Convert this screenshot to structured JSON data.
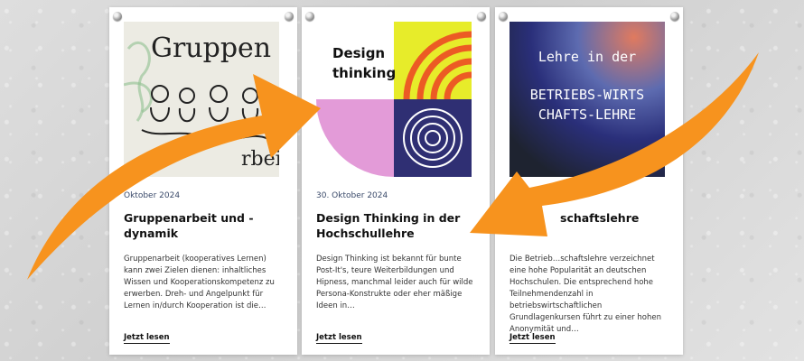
{
  "colors": {
    "arrow": "#f7931e",
    "accent_yellow": "#e7ec2a",
    "accent_orange": "#ec5b24",
    "accent_pink": "#e39bd8",
    "accent_navy": "#2f2f73"
  },
  "cards": [
    {
      "image_text_top": "Gruppen",
      "image_text_bottom": "rbeiten",
      "date": "Oktober 2024",
      "title": "Gruppenarbeit und -dynamik",
      "excerpt": "Gruppenarbeit (kooperatives Lernen) kann zwei Zielen dienen: inhaltliches Wissen und Kooperationskompetenz zu erwerben. Dreh- und Angelpunkt für Lernen in/durch Kooperation ist die…",
      "read_more": "Jetzt lesen"
    },
    {
      "image_text": "Design thinking",
      "date": "30. Oktober 2024",
      "title": "Design Thinking in der Hochschullehre",
      "excerpt": "Design Thinking ist bekannt für bunte Post-It's, teure Weiterbildungen und Hipness, manchmal leider auch für wilde Persona-Konstrukte oder eher mäßige Ideen in…",
      "read_more": "Jetzt lesen"
    },
    {
      "image_text_top": "Lehre in der",
      "image_text_bottom": "BETRIEBS-WIRTSCHAFTS-LEHRE",
      "date": "",
      "title": "schaftslehre",
      "excerpt": "Die Betrieb…schaftslehre verzeichnet eine hohe Popularität an deutschen Hochschulen. Die entsprechend hohe Teilnehmendenzahl in betriebswirtschaftlichen Grundlagenkursen führt zu einer hohen Anonymität und…",
      "read_more": "Jetzt lesen"
    }
  ]
}
